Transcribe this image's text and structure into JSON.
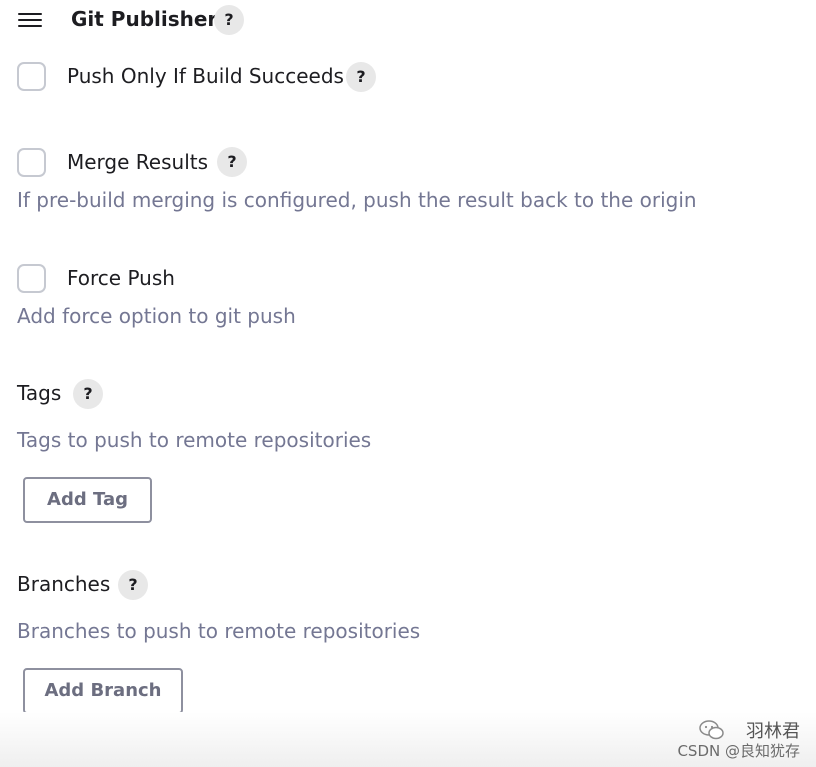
{
  "header": {
    "title": "Git Publisher",
    "help": "?"
  },
  "options": [
    {
      "label": "Push Only If Build Succeeds",
      "checked": false,
      "help": "?",
      "description": ""
    },
    {
      "label": "Merge Results",
      "checked": false,
      "help": "?",
      "description": "If pre-build merging is configured, push the result back to the origin"
    },
    {
      "label": "Force Push",
      "checked": false,
      "description": "Add force option to git push"
    }
  ],
  "tags": {
    "label": "Tags",
    "help": "?",
    "description": "Tags to push to remote repositories",
    "button": "Add Tag"
  },
  "branches": {
    "label": "Branches",
    "help": "?",
    "description": "Branches to push to remote repositories",
    "button": "Add Branch"
  },
  "watermark": {
    "line1": "羽林君",
    "line2": "CSDN @良知犹存"
  },
  "colors": {
    "description_text": "#747793",
    "checkbox_border": "#c6c9d1",
    "help_bg": "#e8e8e8",
    "button_border": "#8e909f"
  }
}
